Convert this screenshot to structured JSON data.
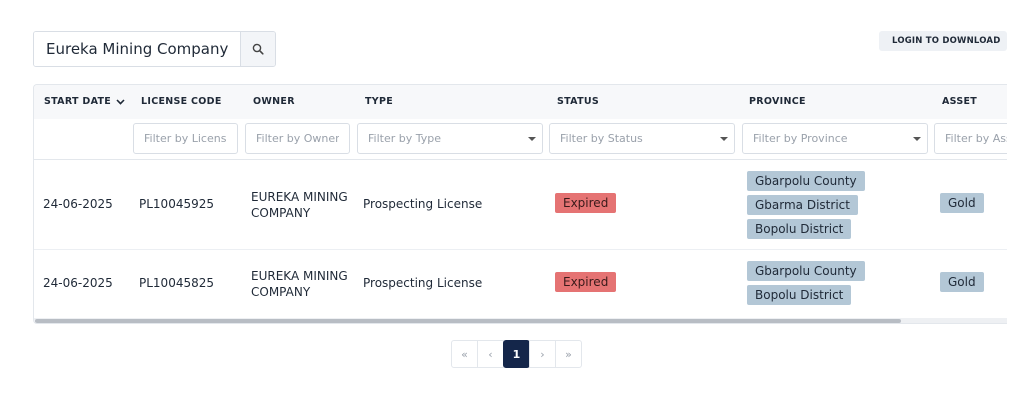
{
  "search": {
    "value": "Eureka Mining Company",
    "button_icon": "search-icon"
  },
  "toolbar": {
    "login_download_label": "LOGIN TO DOWNLOAD",
    "login_download_icon": "download-icon"
  },
  "table": {
    "columns": [
      {
        "label": "START DATE",
        "sort_icon": "chevron-down-icon"
      },
      {
        "label": "LICENSE CODE"
      },
      {
        "label": "OWNER"
      },
      {
        "label": "TYPE"
      },
      {
        "label": "STATUS"
      },
      {
        "label": "PROVINCE"
      },
      {
        "label": "ASSET"
      }
    ],
    "filters": {
      "license_code": "Filter by License Code",
      "owner": "Filter by Owner",
      "type": "Filter by Type",
      "status": "Filter by Status",
      "province": "Filter by Province",
      "asset": "Filter by Asset"
    },
    "rows": [
      {
        "start_date": "24-06-2025",
        "license_code": "PL10045925",
        "owner_line1": "EUREKA MINING",
        "owner_line2": "COMPANY",
        "type": "Prospecting License",
        "status": "Expired",
        "provinces": [
          "Gbarpolu County",
          "Gbarma District",
          "Bopolu District"
        ],
        "asset": "Gold"
      },
      {
        "start_date": "24-06-2025",
        "license_code": "PL10045825",
        "owner_line1": "EUREKA MINING",
        "owner_line2": "COMPANY",
        "type": "Prospecting License",
        "status": "Expired",
        "provinces": [
          "Gbarpolu County",
          "Bopolu District"
        ],
        "asset": "Gold"
      }
    ]
  },
  "pagination": {
    "first": "«",
    "prev": "‹",
    "current": "1",
    "next": "›",
    "last": "»"
  },
  "colors": {
    "status_expired": "#e57373",
    "tag_bg": "#b3c7d6",
    "active_page": "#14264a"
  }
}
